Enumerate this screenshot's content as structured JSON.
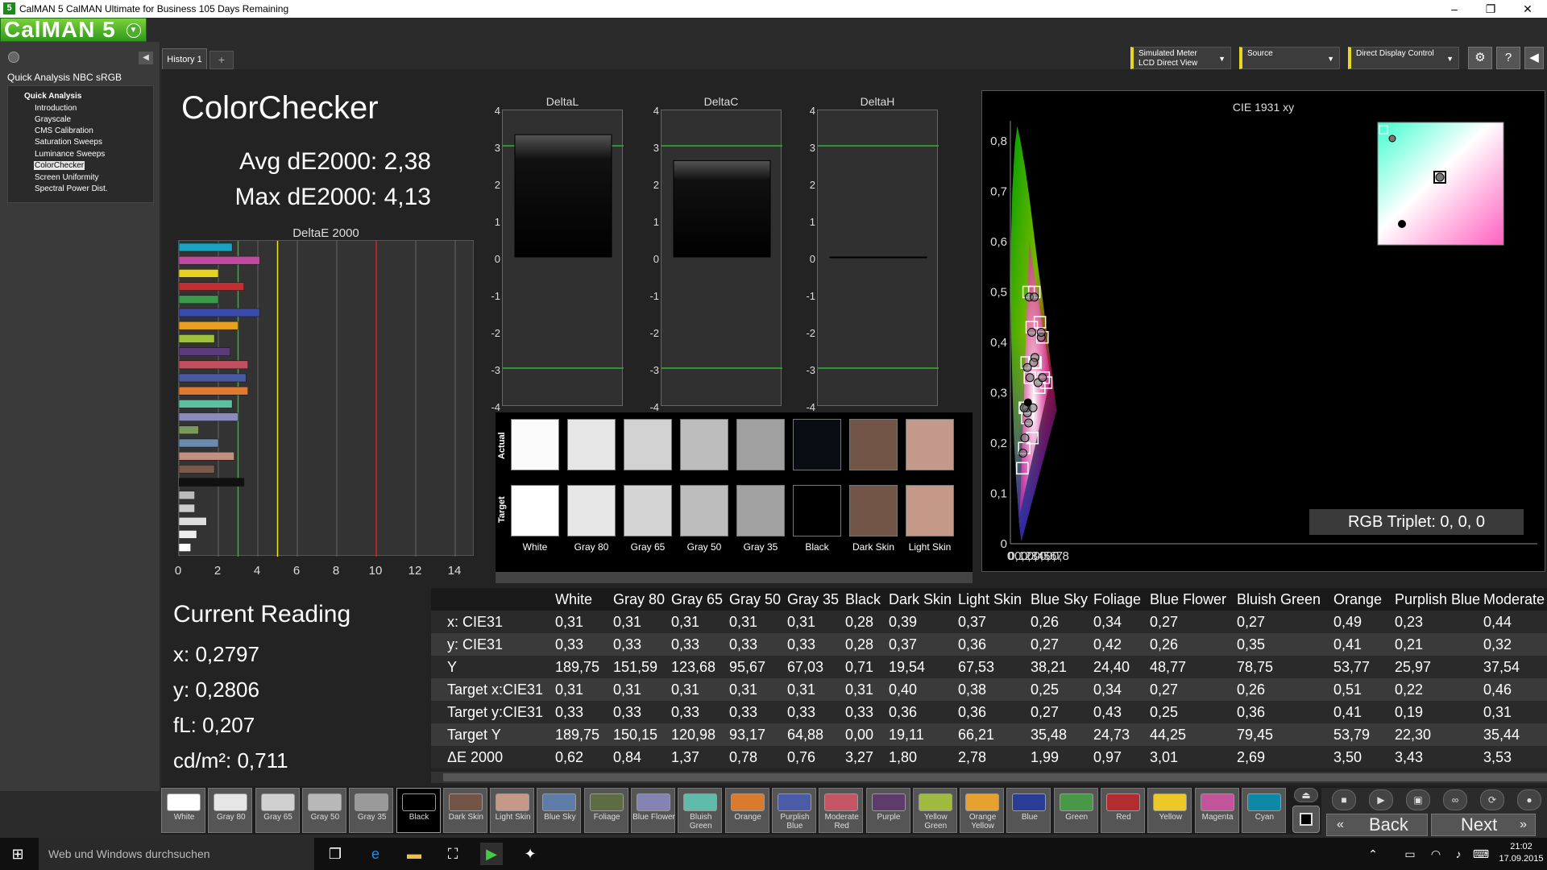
{
  "titlebar": {
    "title": "CalMAN 5 CalMAN Ultimate for Business 105 Days Remaining",
    "app_icon": "5",
    "minimize": "–",
    "restore": "❐",
    "close": "✕"
  },
  "logo": {
    "text": "CalMAN 5"
  },
  "sidebar": {
    "title": "Quick Analysis NBC sRGB",
    "group": "Quick Analysis",
    "items": [
      "Introduction",
      "Grayscale",
      "CMS Calibration",
      "Saturation Sweeps",
      "Luminance Sweeps",
      "ColorChecker",
      "Screen Uniformity",
      "Spectral Power Dist."
    ],
    "selected_index": 5
  },
  "tabs": {
    "history": "History 1",
    "add": "+"
  },
  "controls": {
    "meter_line1": "Simulated Meter",
    "meter_line2": "LCD Direct View",
    "source": "Source",
    "display": "Direct Display Control"
  },
  "page": {
    "title": "ColorChecker",
    "avg": "Avg dE2000: 2,38",
    "max": "Max dE2000: 4,13"
  },
  "deltae_chart": {
    "title": "DeltaE 2000",
    "ticks": [
      "0",
      "2",
      "4",
      "6",
      "8",
      "10",
      "12",
      "14"
    ],
    "xlim": [
      0,
      15
    ],
    "thresholds": [
      {
        "value": 3,
        "color": "#2db52d"
      },
      {
        "value": 5,
        "color": "#e8e820"
      },
      {
        "value": 10,
        "color": "#e02020"
      }
    ],
    "bars": [
      {
        "v": 2.7,
        "c": "#1aa3c0"
      },
      {
        "v": 4.1,
        "c": "#c04aa0"
      },
      {
        "v": 2.0,
        "c": "#e8d020"
      },
      {
        "v": 3.3,
        "c": "#c03030"
      },
      {
        "v": 2.0,
        "c": "#3a9a4a"
      },
      {
        "v": 4.1,
        "c": "#3a4aaa"
      },
      {
        "v": 3.0,
        "c": "#e8a020"
      },
      {
        "v": 1.8,
        "c": "#a0c040"
      },
      {
        "v": 2.6,
        "c": "#5a3a7a"
      },
      {
        "v": 3.5,
        "c": "#c05060"
      },
      {
        "v": 3.4,
        "c": "#4a5aa0"
      },
      {
        "v": 3.5,
        "c": "#e07a30"
      },
      {
        "v": 2.7,
        "c": "#5ac0a0"
      },
      {
        "v": 3.0,
        "c": "#8a8ac0"
      },
      {
        "v": 1.0,
        "c": "#7a9a5a"
      },
      {
        "v": 2.0,
        "c": "#6a8ab0"
      },
      {
        "v": 2.8,
        "c": "#c09080"
      },
      {
        "v": 1.8,
        "c": "#7a5a4a"
      },
      {
        "v": 3.3,
        "c": "#111111"
      },
      {
        "v": 0.8,
        "c": "#bbbbbb"
      },
      {
        "v": 0.8,
        "c": "#cccccc"
      },
      {
        "v": 1.4,
        "c": "#dddddd"
      },
      {
        "v": 0.9,
        "c": "#eeeeee"
      },
      {
        "v": 0.6,
        "c": "#ffffff"
      }
    ]
  },
  "delta_graphs": {
    "labels": [
      "4",
      "3",
      "2",
      "1",
      "0",
      "-1",
      "-2",
      "-3",
      "-4"
    ],
    "items": [
      {
        "title": "DeltaL",
        "value": 3.3
      },
      {
        "title": "DeltaC",
        "value": 2.6
      },
      {
        "title": "DeltaH",
        "value": 0.0
      }
    ]
  },
  "swatches": {
    "actual_label": "Actual",
    "target_label": "Target",
    "items": [
      {
        "name": "White",
        "actual": "#fbfbfb",
        "target": "#ffffff"
      },
      {
        "name": "Gray 80",
        "actual": "#e6e6e6",
        "target": "#e7e7e7"
      },
      {
        "name": "Gray 65",
        "actual": "#d2d2d2",
        "target": "#d4d4d4"
      },
      {
        "name": "Gray 50",
        "actual": "#bdbdbd",
        "target": "#bdbdbd"
      },
      {
        "name": "Gray 35",
        "actual": "#a0a0a0",
        "target": "#a2a2a2"
      },
      {
        "name": "Black",
        "actual": "#0b0d14",
        "target": "#000000"
      },
      {
        "name": "Dark Skin",
        "actual": "#735548",
        "target": "#735547"
      },
      {
        "name": "Light Skin",
        "actual": "#c2998a",
        "target": "#c59987"
      }
    ]
  },
  "cie": {
    "title": "CIE 1931 xy",
    "xticks": [
      "0",
      "0,1",
      "0,2",
      "0,3",
      "0,4",
      "0,5",
      "0,6",
      "0,7",
      "0,8"
    ],
    "yticks": [
      "0",
      "0,1",
      "0,2",
      "0,3",
      "0,4",
      "0,5",
      "0,6",
      "0,7",
      "0,8"
    ],
    "rgb_triplet": "RGB Triplet: 0, 0, 0",
    "gamut": [
      [
        0.64,
        0.33
      ],
      [
        0.3,
        0.6
      ],
      [
        0.15,
        0.06
      ]
    ],
    "targets": [
      [
        0.31,
        0.33
      ],
      [
        0.4,
        0.36
      ],
      [
        0.38,
        0.36
      ],
      [
        0.25,
        0.27
      ],
      [
        0.34,
        0.43
      ],
      [
        0.27,
        0.25
      ],
      [
        0.26,
        0.36
      ],
      [
        0.51,
        0.41
      ],
      [
        0.22,
        0.19
      ],
      [
        0.46,
        0.31
      ],
      [
        0.29,
        0.5
      ],
      [
        0.38,
        0.5
      ],
      [
        0.47,
        0.44
      ],
      [
        0.23,
        0.27
      ],
      [
        0.19,
        0.15
      ],
      [
        0.53,
        0.33
      ],
      [
        0.35,
        0.21
      ],
      [
        0.57,
        0.32
      ]
    ],
    "actuals": [
      [
        0.31,
        0.33
      ],
      [
        0.39,
        0.37
      ],
      [
        0.37,
        0.36
      ],
      [
        0.26,
        0.27
      ],
      [
        0.34,
        0.42
      ],
      [
        0.27,
        0.26
      ],
      [
        0.27,
        0.35
      ],
      [
        0.49,
        0.41
      ],
      [
        0.23,
        0.21
      ],
      [
        0.44,
        0.32
      ],
      [
        0.3,
        0.49
      ],
      [
        0.38,
        0.49
      ],
      [
        0.49,
        0.42
      ],
      [
        0.22,
        0.27
      ],
      [
        0.2,
        0.18
      ],
      [
        0.51,
        0.33
      ],
      [
        0.36,
        0.27
      ],
      [
        0.29,
        0.24
      ]
    ],
    "current": [
      0.2797,
      0.2806
    ]
  },
  "current_reading": {
    "title": "Current Reading",
    "x": "x: 0,2797",
    "y": "y: 0,2806",
    "fl": "fL: 0,207",
    "cd": "cd/m²: 0,711"
  },
  "table": {
    "columns": [
      "",
      "White",
      "Gray 80",
      "Gray 65",
      "Gray 50",
      "Gray 35",
      "Black",
      "Dark Skin",
      "Light Skin",
      "Blue Sky",
      "Foliage",
      "Blue Flower",
      "Bluish Green",
      "Orange",
      "Purplish Blue",
      "Moderate"
    ],
    "rows": [
      [
        "x: CIE31",
        "0,31",
        "0,31",
        "0,31",
        "0,31",
        "0,31",
        "0,28",
        "0,39",
        "0,37",
        "0,26",
        "0,34",
        "0,27",
        "0,27",
        "0,49",
        "0,23",
        "0,44"
      ],
      [
        "y: CIE31",
        "0,33",
        "0,33",
        "0,33",
        "0,33",
        "0,33",
        "0,28",
        "0,37",
        "0,36",
        "0,27",
        "0,42",
        "0,26",
        "0,35",
        "0,41",
        "0,21",
        "0,32"
      ],
      [
        "Y",
        "189,75",
        "151,59",
        "123,68",
        "95,67",
        "67,03",
        "0,71",
        "19,54",
        "67,53",
        "38,21",
        "24,40",
        "48,77",
        "78,75",
        "53,77",
        "25,97",
        "37,54"
      ],
      [
        "Target x:CIE31",
        "0,31",
        "0,31",
        "0,31",
        "0,31",
        "0,31",
        "0,31",
        "0,40",
        "0,38",
        "0,25",
        "0,34",
        "0,27",
        "0,26",
        "0,51",
        "0,22",
        "0,46"
      ],
      [
        "Target y:CIE31",
        "0,33",
        "0,33",
        "0,33",
        "0,33",
        "0,33",
        "0,33",
        "0,36",
        "0,36",
        "0,27",
        "0,43",
        "0,25",
        "0,36",
        "0,41",
        "0,19",
        "0,31"
      ],
      [
        "Target Y",
        "189,75",
        "150,15",
        "120,98",
        "93,17",
        "64,88",
        "0,00",
        "19,11",
        "66,21",
        "35,48",
        "24,73",
        "44,25",
        "79,45",
        "53,79",
        "22,30",
        "35,44"
      ],
      [
        "ΔE 2000",
        "0,62",
        "0,84",
        "1,37",
        "0,78",
        "0,76",
        "3,27",
        "1,80",
        "2,78",
        "1,99",
        "0,97",
        "3,01",
        "2,69",
        "3,50",
        "3,43",
        "3,53"
      ]
    ]
  },
  "patches": [
    {
      "label": "White",
      "c": "#ffffff"
    },
    {
      "label": "Gray 80",
      "c": "#e6e6e6"
    },
    {
      "label": "Gray 65",
      "c": "#d0d0d0"
    },
    {
      "label": "Gray 50",
      "c": "#b8b8b8"
    },
    {
      "label": "Gray 35",
      "c": "#9a9a9a"
    },
    {
      "label": "Black",
      "c": "#000000"
    },
    {
      "label": "Dark Skin",
      "c": "#735548"
    },
    {
      "label": "Light Skin",
      "c": "#c59987"
    },
    {
      "label": "Blue Sky",
      "c": "#5d7da8"
    },
    {
      "label": "Foliage",
      "c": "#5e6c44"
    },
    {
      "label": "Blue Flower",
      "c": "#8582b4"
    },
    {
      "label": "Bluish Green",
      "c": "#5fbcaa"
    },
    {
      "label": "Orange",
      "c": "#da7a2c"
    },
    {
      "label": "Purplish Blue",
      "c": "#4a5ba8"
    },
    {
      "label": "Moderate Red",
      "c": "#c55465"
    },
    {
      "label": "Purple",
      "c": "#5d3c6b"
    },
    {
      "label": "Yellow Green",
      "c": "#9fba3e"
    },
    {
      "label": "Orange Yellow",
      "c": "#e6a12e"
    },
    {
      "label": "Blue",
      "c": "#2a3d96"
    },
    {
      "label": "Green",
      "c": "#489848"
    },
    {
      "label": "Red",
      "c": "#b32c30"
    },
    {
      "label": "Yellow",
      "c": "#ecc927"
    },
    {
      "label": "Magenta",
      "c": "#c1549b"
    },
    {
      "label": "Cyan",
      "c": "#0d89a7"
    }
  ],
  "selected_patch": 5,
  "transport": {
    "back": "Back",
    "next": "Next"
  },
  "taskbar": {
    "search": "Web und Windows durchsuchen",
    "time": "21:02",
    "date": "17.09.2015"
  }
}
